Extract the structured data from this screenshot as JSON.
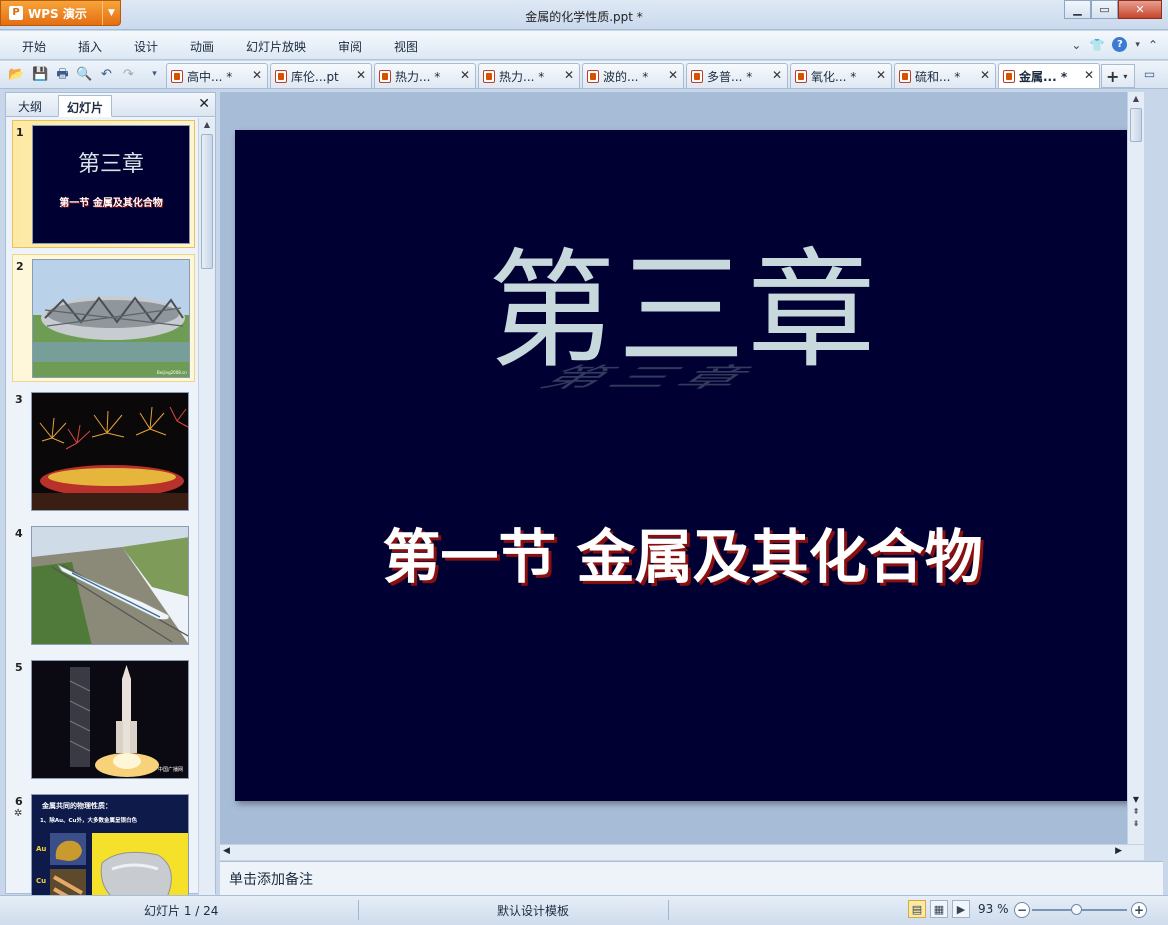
{
  "app": {
    "name": "WPS 演示",
    "logo_letter": "P"
  },
  "window": {
    "title": "金属的化学性质.ppt *"
  },
  "menu": [
    "开始",
    "插入",
    "设计",
    "动画",
    "幻灯片放映",
    "审阅",
    "视图"
  ],
  "tabs": [
    {
      "label": "高中... *"
    },
    {
      "label": "库伦...pt"
    },
    {
      "label": "热力... *"
    },
    {
      "label": "热力... *"
    },
    {
      "label": "波的... *"
    },
    {
      "label": "多普... *"
    },
    {
      "label": "氧化... *"
    },
    {
      "label": "硫和... *"
    },
    {
      "label": "金属... *",
      "active": true
    }
  ],
  "panel": {
    "tab_outline": "大纲",
    "tab_slides": "幻灯片"
  },
  "thumbnails": [
    {
      "num": "1",
      "title": "第三章",
      "subtitle": "第一节  金属及其化合物"
    },
    {
      "num": "2",
      "description": "bird-nest-stadium",
      "watermark": "Beijing2008.cn"
    },
    {
      "num": "3",
      "description": "fireworks"
    },
    {
      "num": "4",
      "description": "high-speed-train"
    },
    {
      "num": "5",
      "description": "rocket-launch",
      "watermark": "中国广播网"
    },
    {
      "num": "6",
      "star": "✲",
      "heading": "金属共同的物理性质：",
      "line": "1、除Au、Cu外，大多数金属呈银白色",
      "labels": [
        "Au",
        "Cu"
      ]
    }
  ],
  "slide": {
    "title": "第三章",
    "subtitle": "第一节  金属及其化合物",
    "bg": "#000033"
  },
  "notes": {
    "placeholder": "单击添加备注"
  },
  "status": {
    "slide_count": "幻灯片 1 / 24",
    "template": "默认设计模板",
    "zoom": "93 %"
  }
}
